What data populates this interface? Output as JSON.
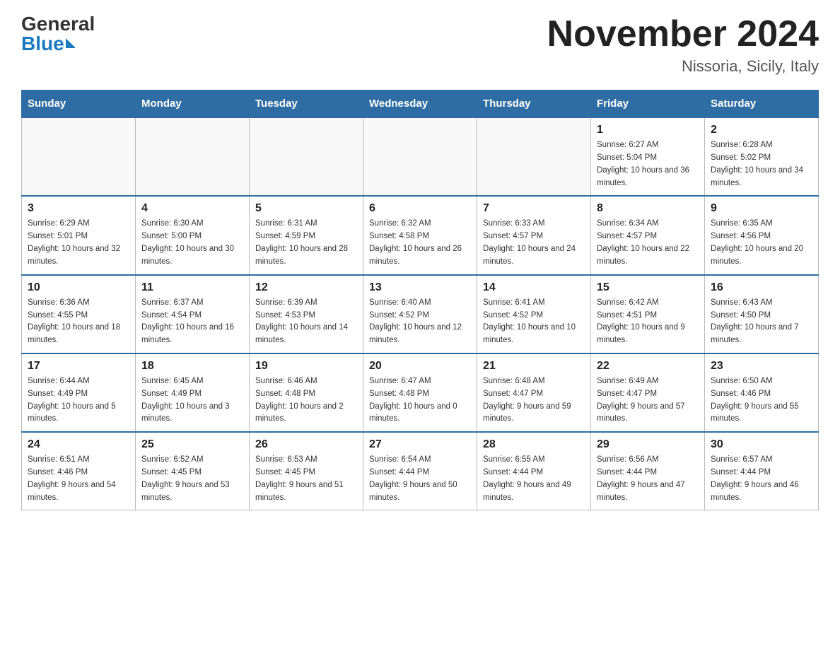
{
  "header": {
    "logo_general": "General",
    "logo_blue": "Blue",
    "month_title": "November 2024",
    "location": "Nissoria, Sicily, Italy"
  },
  "calendar": {
    "days_of_week": [
      "Sunday",
      "Monday",
      "Tuesday",
      "Wednesday",
      "Thursday",
      "Friday",
      "Saturday"
    ],
    "weeks": [
      [
        {
          "day": "",
          "info": ""
        },
        {
          "day": "",
          "info": ""
        },
        {
          "day": "",
          "info": ""
        },
        {
          "day": "",
          "info": ""
        },
        {
          "day": "",
          "info": ""
        },
        {
          "day": "1",
          "info": "Sunrise: 6:27 AM\nSunset: 5:04 PM\nDaylight: 10 hours and 36 minutes."
        },
        {
          "day": "2",
          "info": "Sunrise: 6:28 AM\nSunset: 5:02 PM\nDaylight: 10 hours and 34 minutes."
        }
      ],
      [
        {
          "day": "3",
          "info": "Sunrise: 6:29 AM\nSunset: 5:01 PM\nDaylight: 10 hours and 32 minutes."
        },
        {
          "day": "4",
          "info": "Sunrise: 6:30 AM\nSunset: 5:00 PM\nDaylight: 10 hours and 30 minutes."
        },
        {
          "day": "5",
          "info": "Sunrise: 6:31 AM\nSunset: 4:59 PM\nDaylight: 10 hours and 28 minutes."
        },
        {
          "day": "6",
          "info": "Sunrise: 6:32 AM\nSunset: 4:58 PM\nDaylight: 10 hours and 26 minutes."
        },
        {
          "day": "7",
          "info": "Sunrise: 6:33 AM\nSunset: 4:57 PM\nDaylight: 10 hours and 24 minutes."
        },
        {
          "day": "8",
          "info": "Sunrise: 6:34 AM\nSunset: 4:57 PM\nDaylight: 10 hours and 22 minutes."
        },
        {
          "day": "9",
          "info": "Sunrise: 6:35 AM\nSunset: 4:56 PM\nDaylight: 10 hours and 20 minutes."
        }
      ],
      [
        {
          "day": "10",
          "info": "Sunrise: 6:36 AM\nSunset: 4:55 PM\nDaylight: 10 hours and 18 minutes."
        },
        {
          "day": "11",
          "info": "Sunrise: 6:37 AM\nSunset: 4:54 PM\nDaylight: 10 hours and 16 minutes."
        },
        {
          "day": "12",
          "info": "Sunrise: 6:39 AM\nSunset: 4:53 PM\nDaylight: 10 hours and 14 minutes."
        },
        {
          "day": "13",
          "info": "Sunrise: 6:40 AM\nSunset: 4:52 PM\nDaylight: 10 hours and 12 minutes."
        },
        {
          "day": "14",
          "info": "Sunrise: 6:41 AM\nSunset: 4:52 PM\nDaylight: 10 hours and 10 minutes."
        },
        {
          "day": "15",
          "info": "Sunrise: 6:42 AM\nSunset: 4:51 PM\nDaylight: 10 hours and 9 minutes."
        },
        {
          "day": "16",
          "info": "Sunrise: 6:43 AM\nSunset: 4:50 PM\nDaylight: 10 hours and 7 minutes."
        }
      ],
      [
        {
          "day": "17",
          "info": "Sunrise: 6:44 AM\nSunset: 4:49 PM\nDaylight: 10 hours and 5 minutes."
        },
        {
          "day": "18",
          "info": "Sunrise: 6:45 AM\nSunset: 4:49 PM\nDaylight: 10 hours and 3 minutes."
        },
        {
          "day": "19",
          "info": "Sunrise: 6:46 AM\nSunset: 4:48 PM\nDaylight: 10 hours and 2 minutes."
        },
        {
          "day": "20",
          "info": "Sunrise: 6:47 AM\nSunset: 4:48 PM\nDaylight: 10 hours and 0 minutes."
        },
        {
          "day": "21",
          "info": "Sunrise: 6:48 AM\nSunset: 4:47 PM\nDaylight: 9 hours and 59 minutes."
        },
        {
          "day": "22",
          "info": "Sunrise: 6:49 AM\nSunset: 4:47 PM\nDaylight: 9 hours and 57 minutes."
        },
        {
          "day": "23",
          "info": "Sunrise: 6:50 AM\nSunset: 4:46 PM\nDaylight: 9 hours and 55 minutes."
        }
      ],
      [
        {
          "day": "24",
          "info": "Sunrise: 6:51 AM\nSunset: 4:46 PM\nDaylight: 9 hours and 54 minutes."
        },
        {
          "day": "25",
          "info": "Sunrise: 6:52 AM\nSunset: 4:45 PM\nDaylight: 9 hours and 53 minutes."
        },
        {
          "day": "26",
          "info": "Sunrise: 6:53 AM\nSunset: 4:45 PM\nDaylight: 9 hours and 51 minutes."
        },
        {
          "day": "27",
          "info": "Sunrise: 6:54 AM\nSunset: 4:44 PM\nDaylight: 9 hours and 50 minutes."
        },
        {
          "day": "28",
          "info": "Sunrise: 6:55 AM\nSunset: 4:44 PM\nDaylight: 9 hours and 49 minutes."
        },
        {
          "day": "29",
          "info": "Sunrise: 6:56 AM\nSunset: 4:44 PM\nDaylight: 9 hours and 47 minutes."
        },
        {
          "day": "30",
          "info": "Sunrise: 6:57 AM\nSunset: 4:44 PM\nDaylight: 9 hours and 46 minutes."
        }
      ]
    ]
  }
}
